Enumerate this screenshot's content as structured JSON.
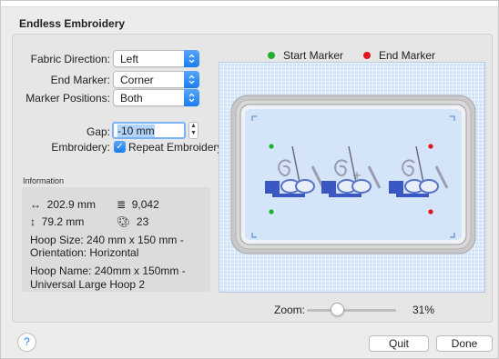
{
  "dialog": {
    "title": "Endless Embroidery"
  },
  "settings": {
    "fabric_direction": {
      "label": "Fabric Direction:",
      "value": "Left"
    },
    "end_marker": {
      "label": "End Marker:",
      "value": "Corner"
    },
    "marker_positions": {
      "label": "Marker Positions:",
      "value": "Both"
    },
    "gap": {
      "label": "Gap:",
      "value": "-10 mm"
    },
    "embroidery": {
      "label": "Embroidery:",
      "option": "Repeat Embroidery",
      "checked": true
    }
  },
  "information": {
    "title": "Information",
    "width": "202.9 mm",
    "height": "79.2 mm",
    "stitches": "9,042",
    "colors": "23",
    "hoop_size": "Hoop Size: 240 mm x 150 mm -",
    "orientation": "Orientation: Horizontal",
    "hoop_name_1": "Hoop Name: 240mm x 150mm -",
    "hoop_name_2": "Universal Large Hoop 2"
  },
  "legend": {
    "start": {
      "label": "Start Marker",
      "color": "#20b02a"
    },
    "end": {
      "label": "End Marker",
      "color": "#e2141e"
    }
  },
  "zoom": {
    "label": "Zoom:",
    "value": "31%",
    "level": 0.31
  },
  "buttons": {
    "help": "?",
    "quit": "Quit",
    "done": "Done"
  }
}
